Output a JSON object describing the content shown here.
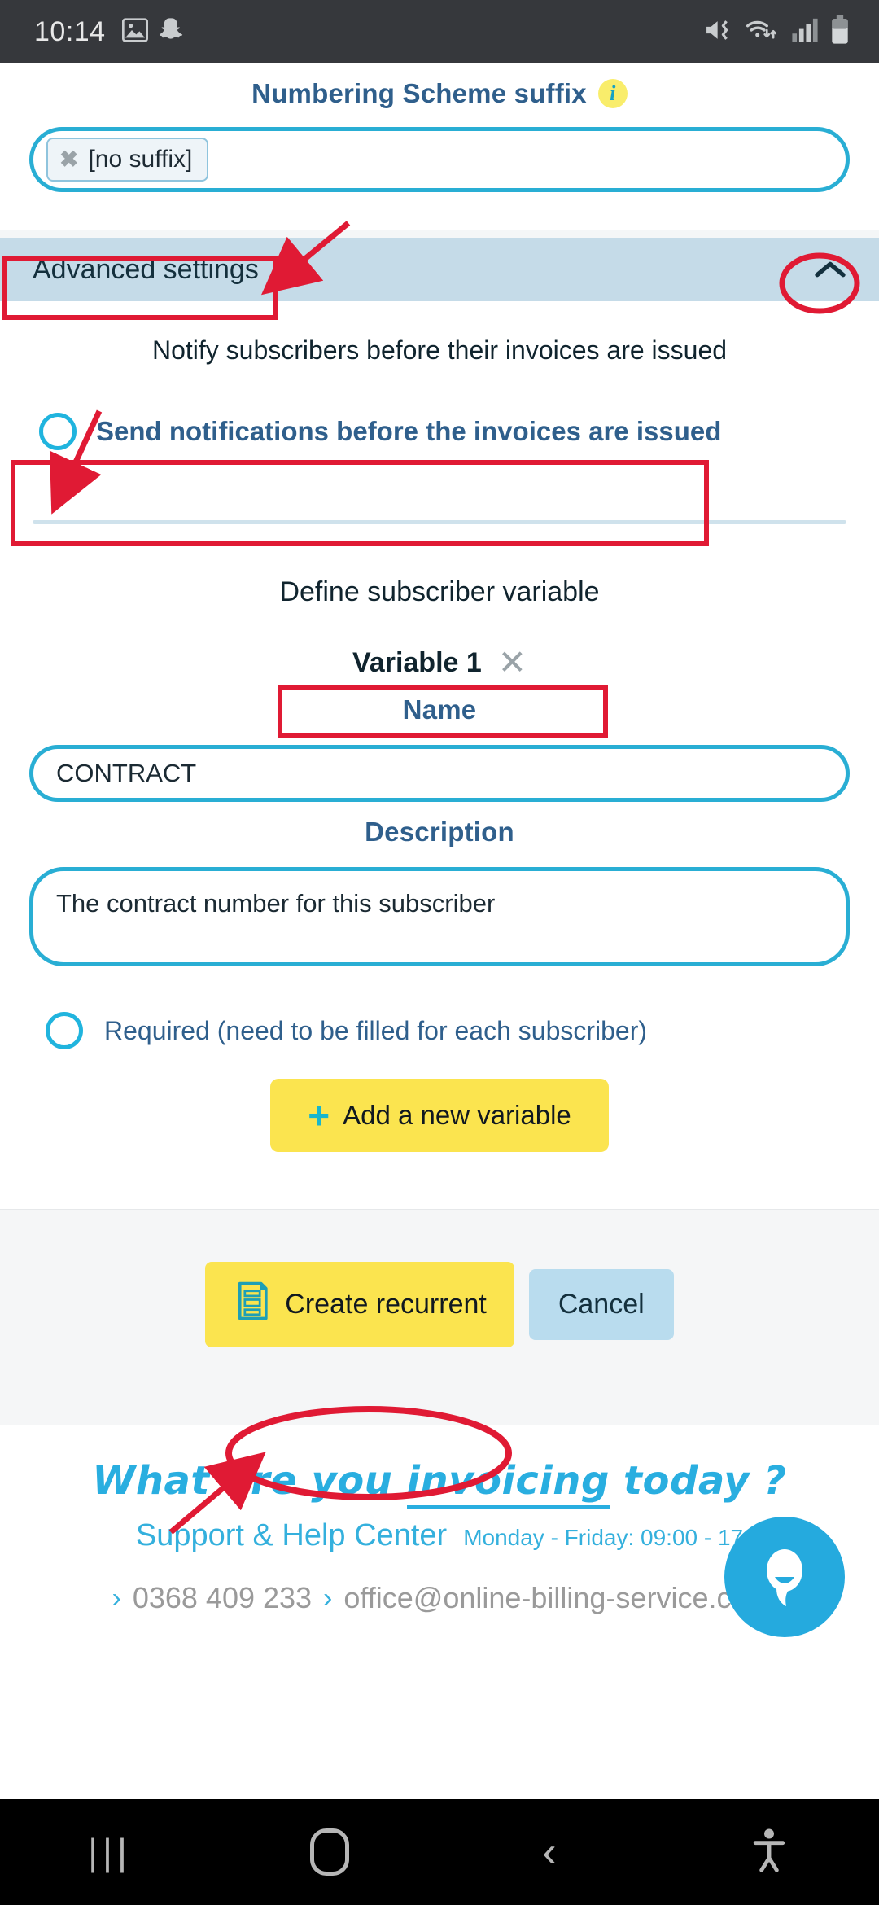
{
  "status_bar": {
    "time": "10:14",
    "left_icons": [
      "image-icon",
      "snapchat-icon"
    ],
    "right_icons": [
      "mute-vibrate-icon",
      "wifi-icon",
      "signal-icon",
      "battery-icon"
    ]
  },
  "numbering_scheme": {
    "label": "Numbering Scheme suffix",
    "info_badge": "i",
    "chip_value": "[no suffix]",
    "chip_remove": "✖"
  },
  "advanced_settings": {
    "title": "Advanced settings",
    "chevron": "chevron-up-icon"
  },
  "notifications": {
    "note": "Notify subscribers before their invoices are issued",
    "option_label": "Send notifications before the invoices are issued",
    "checked": false
  },
  "subscriber_variable": {
    "section_title": "Define subscriber variable",
    "variable_title": "Variable 1",
    "remove_icon": "✕",
    "name_label": "Name",
    "name_value": "CONTRACT",
    "description_label": "Description",
    "description_value": "The contract number for this  subscriber",
    "required_label": "Required (need to be filled for each subscriber)",
    "required_checked": false,
    "add_button_label": "Add a new variable",
    "add_button_icon": "plus-icon"
  },
  "actions": {
    "create_label": "Create recurrent",
    "create_icon": "invoice-icon",
    "cancel_label": "Cancel"
  },
  "footer": {
    "slogan_part1": "What are you ",
    "slogan_underlined": "invoicing",
    "slogan_part2": " today ?",
    "support_title": "Support & Help Center",
    "support_hours": "Monday - Friday: 09:00 - 17",
    "phone": "0368 409 233",
    "email": "office@online-billing-service.com",
    "chevron": "›",
    "chat_icon": "chat-bubble-icon"
  },
  "nav_bar": {
    "recent_icon": "|||",
    "home_icon": "home-icon",
    "back_icon": "‹",
    "accessibility_icon": "accessibility-icon"
  },
  "colors": {
    "accent_blue": "#29aed4",
    "heading_blue": "#2f5f8c",
    "yellow": "#fbe44f",
    "panel_blue": "#c5dbe8",
    "annotation_red": "#e01a34",
    "footer_cyan": "#29aee0"
  }
}
